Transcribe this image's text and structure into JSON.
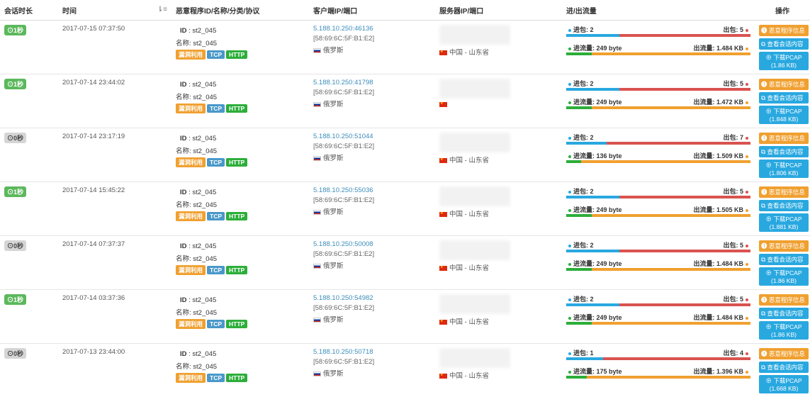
{
  "headers": {
    "duration": "会话时长",
    "time": "时间",
    "malware": "恶意程序ID/名称/分类/协议",
    "client": "客户端IP/端口",
    "server": "服务器IP/端口",
    "flow": "进/出流量",
    "ops": "操作"
  },
  "labels": {
    "id": "ID",
    "name": "名称:",
    "in_pkt": "进包:",
    "out_pkt": "出包:",
    "in_flow": "进流量:",
    "out_flow": "出流量:",
    "btn_malware": "恶意程序信息",
    "btn_session": "查看会话内容",
    "btn_pcap": "下载PCAP"
  },
  "colors": {
    "green": "#5cb85c",
    "blue": "#29a8e0",
    "red": "#d9534f",
    "orange": "#f0a030",
    "flowgreen": "#2cae3a"
  },
  "rows": [
    {
      "duration": "1秒",
      "dur_active": true,
      "time": "2017-07-15 07:37:50",
      "id": "st2_045",
      "name": "st2_045",
      "tags": [
        "漏洞利用",
        "TCP",
        "HTTP"
      ],
      "ip": "5.188.10.250",
      "port": ":46136",
      "mac": "[58:69:6C:5F:B1:E2]",
      "country": "俄罗斯",
      "server_loc": "中国 - 山东省",
      "in_pkt": "2",
      "out_pkt": "5",
      "in_flow": "249 byte",
      "out_flow": "1.484 KB",
      "pkt_ratio": 0.29,
      "flow_ratio": 0.14,
      "pcap": "(1.86 KB)"
    },
    {
      "duration": "1秒",
      "dur_active": true,
      "time": "2017-07-14 23:44:02",
      "id": "st2_045",
      "name": "st2_045",
      "tags": [
        "漏洞利用",
        "TCP",
        "HTTP"
      ],
      "ip": "5.188.10.250",
      "port": ":41798",
      "mac": "[58:69:6C:5F:B1:E2]",
      "country": "俄罗斯",
      "server_loc": "",
      "in_pkt": "2",
      "out_pkt": "5",
      "in_flow": "249 byte",
      "out_flow": "1.472 KB",
      "pkt_ratio": 0.29,
      "flow_ratio": 0.14,
      "pcap": "(1.848 KB)"
    },
    {
      "duration": "0秒",
      "dur_active": false,
      "time": "2017-07-14 23:17:19",
      "id": "st2_045",
      "name": "st2_045",
      "tags": [
        "漏洞利用",
        "TCP",
        "HTTP"
      ],
      "ip": "5.188.10.250",
      "port": ":51044",
      "mac": "[58:69:6C:5F:B1:E2]",
      "country": "俄罗斯",
      "server_loc": "中国 - 山东省",
      "in_pkt": "2",
      "out_pkt": "7",
      "in_flow": "136 byte",
      "out_flow": "1.509 KB",
      "pkt_ratio": 0.22,
      "flow_ratio": 0.08,
      "pcap": "(1.806 KB)"
    },
    {
      "duration": "1秒",
      "dur_active": true,
      "time": "2017-07-14 15:45:22",
      "id": "st2_045",
      "name": "st2_045",
      "tags": [
        "漏洞利用",
        "TCP",
        "HTTP"
      ],
      "ip": "5.188.10.250",
      "port": ":55036",
      "mac": "[58:69:6C:5F:B1:E2]",
      "country": "俄罗斯",
      "server_loc": "中国 - 山东省",
      "in_pkt": "2",
      "out_pkt": "5",
      "in_flow": "249 byte",
      "out_flow": "1.505 KB",
      "pkt_ratio": 0.29,
      "flow_ratio": 0.14,
      "pcap": "(1.881 KB)"
    },
    {
      "duration": "0秒",
      "dur_active": false,
      "time": "2017-07-14 07:37:37",
      "id": "st2_045",
      "name": "st2_045",
      "tags": [
        "漏洞利用",
        "TCP",
        "HTTP"
      ],
      "ip": "5.188.10.250",
      "port": ":50008",
      "mac": "[58:69:6C:5F:B1:E2]",
      "country": "俄罗斯",
      "server_loc": "中国 - 山东省",
      "in_pkt": "2",
      "out_pkt": "5",
      "in_flow": "249 byte",
      "out_flow": "1.484 KB",
      "pkt_ratio": 0.29,
      "flow_ratio": 0.14,
      "pcap": "(1.86 KB)"
    },
    {
      "duration": "1秒",
      "dur_active": true,
      "time": "2017-07-14 03:37:36",
      "id": "st2_045",
      "name": "st2_045",
      "tags": [
        "漏洞利用",
        "TCP",
        "HTTP"
      ],
      "ip": "5.188.10.250",
      "port": ":54982",
      "mac": "[58:69:6C:5F:B1:E2]",
      "country": "俄罗斯",
      "server_loc": "中国 - 山东省",
      "in_pkt": "2",
      "out_pkt": "5",
      "in_flow": "249 byte",
      "out_flow": "1.484 KB",
      "pkt_ratio": 0.29,
      "flow_ratio": 0.14,
      "pcap": "(1.86 KB)"
    },
    {
      "duration": "0秒",
      "dur_active": false,
      "time": "2017-07-13 23:44:00",
      "id": "st2_045",
      "name": "st2_045",
      "tags": [
        "漏洞利用",
        "TCP",
        "HTTP"
      ],
      "ip": "5.188.10.250",
      "port": ":50718",
      "mac": "[58:69:6C:5F:B1:E2]",
      "country": "俄罗斯",
      "server_loc": "中国 - 山东省",
      "in_pkt": "1",
      "out_pkt": "4",
      "in_flow": "175 byte",
      "out_flow": "1.396 KB",
      "pkt_ratio": 0.2,
      "flow_ratio": 0.11,
      "pcap": "(1.668 KB)"
    }
  ]
}
